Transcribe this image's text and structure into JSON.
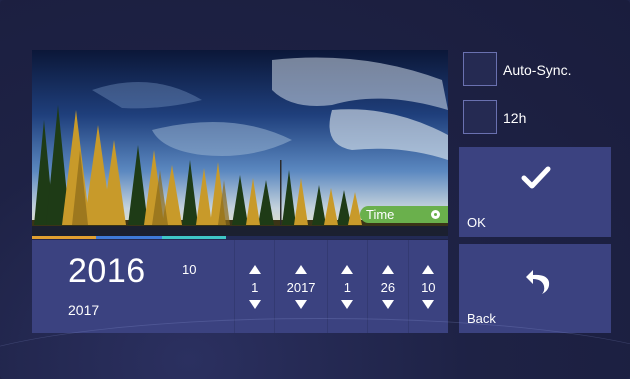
{
  "colors": {
    "panel": "#3b4280",
    "background": "#1f2347",
    "time_badge": "#6ab04c",
    "progress_orange": "#e0a030",
    "progress_blue": "#3f7ad8",
    "progress_teal": "#3fc6c6"
  },
  "preview": {
    "badge_label": "Time",
    "badge_icon": "toggle-dot-icon"
  },
  "date": {
    "year_large": "2016",
    "month_large": "10",
    "year_small": "2017"
  },
  "spinners": [
    {
      "id": "month",
      "value": "1"
    },
    {
      "id": "year",
      "value": "2017"
    },
    {
      "id": "day",
      "value": "1"
    },
    {
      "id": "hour",
      "value": "26"
    },
    {
      "id": "minute",
      "value": "10"
    }
  ],
  "options": {
    "auto_sync_label": "Auto-Sync.",
    "hour12_label": "12h"
  },
  "buttons": {
    "ok_label": "OK",
    "ok_icon": "checkmark-icon",
    "back_label": "Back",
    "back_icon": "back-arrow-icon"
  }
}
